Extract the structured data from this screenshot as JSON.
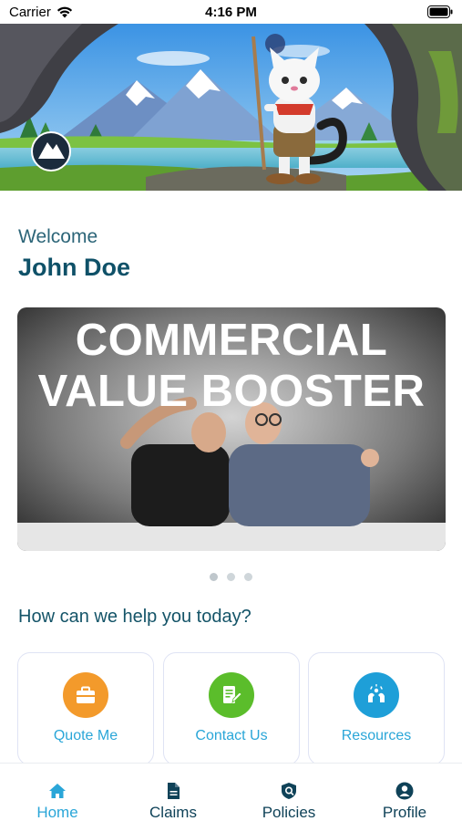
{
  "status_bar": {
    "carrier": "Carrier",
    "time": "4:16 PM"
  },
  "hero": {
    "badge_icon": "mountain-badge-logo",
    "mascot": "snow-leopard-hiker"
  },
  "greeting": {
    "welcome": "Welcome",
    "name": "John Doe"
  },
  "carousel": {
    "title_line1": "COMMERCIAL",
    "title_line2": "VALUE BOOSTER",
    "slide_count": 3,
    "active_index": 0
  },
  "help": {
    "heading": "How can we help you today?"
  },
  "actions": [
    {
      "label": "Quote Me",
      "icon": "briefcase-icon",
      "color": "#f39a2b"
    },
    {
      "label": "Contact Us",
      "icon": "document-edit-icon",
      "color": "#5bbd2b"
    },
    {
      "label": "Resources",
      "icon": "handshake-icon",
      "color": "#1e9fd8"
    }
  ],
  "tabs": [
    {
      "label": "Home",
      "icon": "home-icon",
      "active": true
    },
    {
      "label": "Claims",
      "icon": "file-icon",
      "active": false
    },
    {
      "label": "Policies",
      "icon": "shield-icon",
      "active": false
    },
    {
      "label": "Profile",
      "icon": "user-circle-icon",
      "active": false
    }
  ],
  "colors": {
    "accent": "#2aa6d8",
    "primary_text": "#0f5168",
    "card_border": "#dfe3f4"
  }
}
